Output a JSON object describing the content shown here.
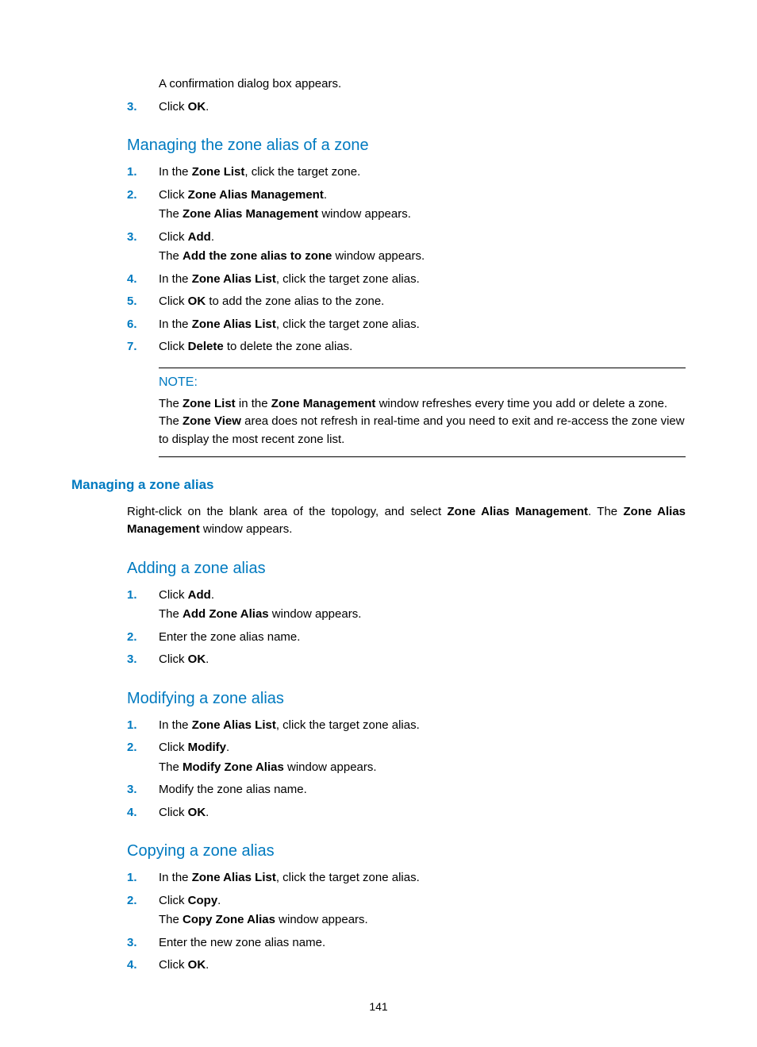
{
  "top": {
    "line1": "A confirmation dialog box appears.",
    "item3_num": "3.",
    "item3_a": "Click ",
    "item3_b": "OK",
    "item3_c": "."
  },
  "sec1": {
    "title": "Managing the zone alias of a zone",
    "s1_num": "1.",
    "s1_a": "In the ",
    "s1_b": "Zone List",
    "s1_c": ", click the target zone.",
    "s2_num": "2.",
    "s2_a": "Click ",
    "s2_b": "Zone Alias Management",
    "s2_c": ".",
    "s2_sub_a": "The ",
    "s2_sub_b": "Zone Alias Management",
    "s2_sub_c": " window appears.",
    "s3_num": "3.",
    "s3_a": "Click ",
    "s3_b": "Add",
    "s3_c": ".",
    "s3_sub_a": "The ",
    "s3_sub_b": "Add the zone alias to zone",
    "s3_sub_c": " window appears.",
    "s4_num": "4.",
    "s4_a": "In the ",
    "s4_b": "Zone Alias List",
    "s4_c": ", click the target zone alias.",
    "s5_num": "5.",
    "s5_a": "Click ",
    "s5_b": "OK",
    "s5_c": " to add the zone alias to the zone.",
    "s6_num": "6.",
    "s6_a": "In the ",
    "s6_b": "Zone Alias List",
    "s6_c": ", click the target zone alias.",
    "s7_num": "7.",
    "s7_a": "Click ",
    "s7_b": "Delete",
    "s7_c": " to delete the zone alias."
  },
  "note": {
    "title": "NOTE:",
    "a": "The ",
    "b": "Zone List",
    "c": " in the ",
    "d": "Zone Management",
    "e": " window refreshes every time you add or delete a zone. The ",
    "f": "Zone View",
    "g": " area does not refresh in real-time and you need to exit and re-access the zone view to display the most recent zone list."
  },
  "sec2": {
    "title": "Managing a zone alias",
    "p_a": "Right-click on the blank area of the topology, and select ",
    "p_b": "Zone Alias Management",
    "p_c": ". The ",
    "p_d": "Zone Alias Management",
    "p_e": " window appears."
  },
  "sec3": {
    "title": "Adding a zone alias",
    "s1_num": "1.",
    "s1_a": "Click ",
    "s1_b": "Add",
    "s1_c": ".",
    "s1_sub_a": "The ",
    "s1_sub_b": "Add Zone Alias",
    "s1_sub_c": " window appears.",
    "s2_num": "2.",
    "s2": "Enter the zone alias name.",
    "s3_num": "3.",
    "s3_a": "Click ",
    "s3_b": "OK",
    "s3_c": "."
  },
  "sec4": {
    "title": "Modifying a zone alias",
    "s1_num": "1.",
    "s1_a": "In the ",
    "s1_b": "Zone Alias List",
    "s1_c": ", click the target zone alias.",
    "s2_num": "2.",
    "s2_a": "Click ",
    "s2_b": "Modify",
    "s2_c": ".",
    "s2_sub_a": "The ",
    "s2_sub_b": "Modify Zone Alias",
    "s2_sub_c": " window appears.",
    "s3_num": "3.",
    "s3": "Modify the zone alias name.",
    "s4_num": "4.",
    "s4_a": "Click ",
    "s4_b": "OK",
    "s4_c": "."
  },
  "sec5": {
    "title": "Copying a zone alias",
    "s1_num": "1.",
    "s1_a": "In the ",
    "s1_b": "Zone Alias List",
    "s1_c": ", click the target zone alias.",
    "s2_num": "2.",
    "s2_a": "Click ",
    "s2_b": "Copy",
    "s2_c": ".",
    "s2_sub_a": "The ",
    "s2_sub_b": "Copy Zone Alias",
    "s2_sub_c": " window appears.",
    "s3_num": "3.",
    "s3": "Enter the new zone alias name.",
    "s4_num": "4.",
    "s4_a": "Click ",
    "s4_b": "OK",
    "s4_c": "."
  },
  "page_number": "141"
}
